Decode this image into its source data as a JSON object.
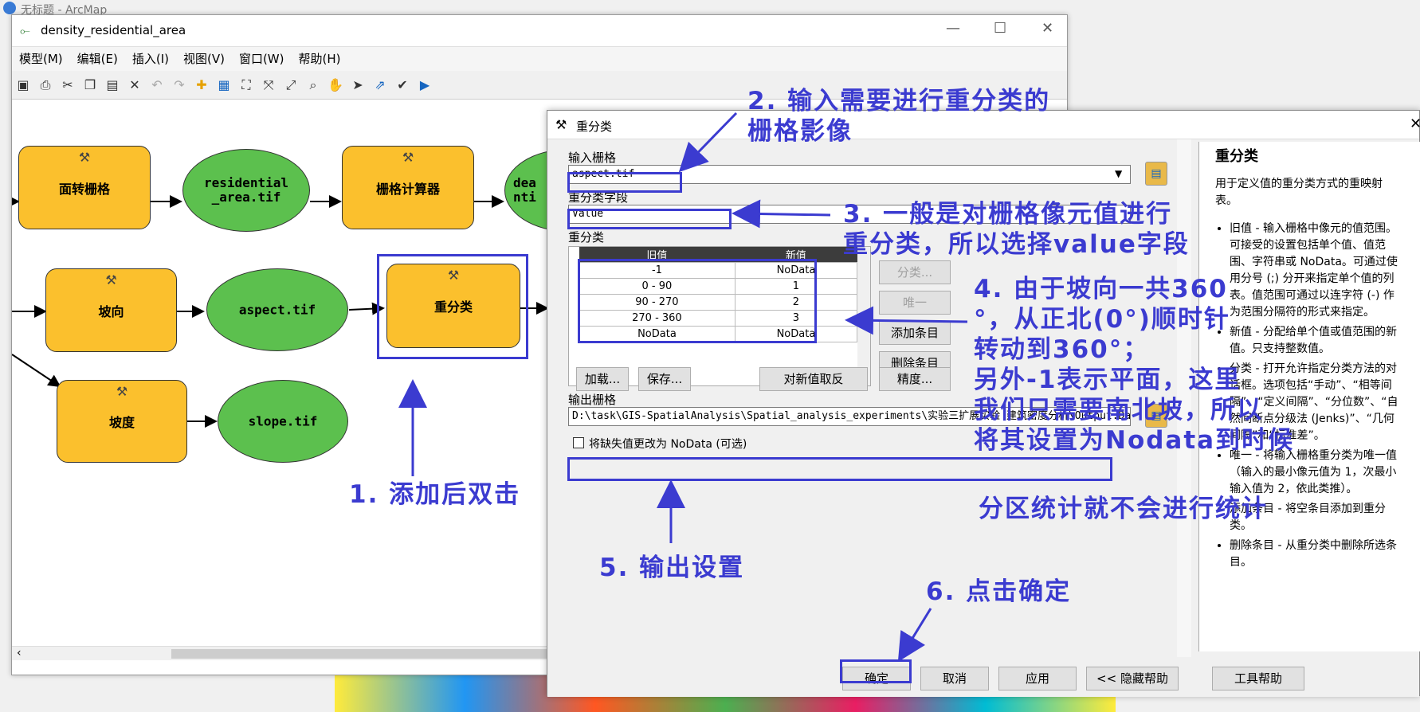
{
  "arcmap": {
    "title": "无标题 - ArcMap"
  },
  "modelbuilder": {
    "title": "density_residential_area",
    "menu": [
      "模型(M)",
      "编辑(E)",
      "插入(I)",
      "视图(V)",
      "窗口(W)",
      "帮助(H)"
    ],
    "nodes": {
      "polygon_to_raster": "面转栅格",
      "residential_tif": "residential\n_area.tif",
      "raster_calc": "栅格计算器",
      "den_partial": "dea\nnti",
      "aspect": "坡向",
      "aspect_tif": "aspect.tif",
      "reclassify": "重分类",
      "slope": "坡度",
      "slope_tif": "slope.tif"
    }
  },
  "dialog": {
    "title": "重分类",
    "input_label": "输入栅格",
    "input_value": "aspect.tif",
    "field_label": "重分类字段",
    "field_value": "Value",
    "reclass_label": "重分类",
    "table_headers": [
      "旧值",
      "新值"
    ],
    "table_rows": [
      [
        "-1",
        "NoData"
      ],
      [
        "0 - 90",
        "1"
      ],
      [
        "90 - 270",
        "2"
      ],
      [
        "270 - 360",
        "3"
      ],
      [
        "NoData",
        "NoData"
      ]
    ],
    "side_buttons": [
      "分类...",
      "唯一",
      "添加条目",
      "删除条目"
    ],
    "bottom_buttons": [
      "加载...",
      "保存...",
      "对新值取反",
      "精度..."
    ],
    "output_label": "输出栅格",
    "output_value": "D:\\task\\GIS-SpatialAnalysis\\Spatial_analysis_experiments\\实验三扩展实验 建筑密度分析\\Output.Dat",
    "nodata_checkbox": "将缺失值更改为 NoData (可选)",
    "ok": "确定",
    "cancel": "取消",
    "apply": "应用",
    "hide_help": "<< 隐藏帮助",
    "tool_help": "工具帮助"
  },
  "help": {
    "title": "重分类",
    "intro": "用于定义值的重分类方式的重映射表。",
    "items": [
      "旧值 - 输入栅格中像元的值范围。可接受的设置包括单个值、值范围、字符串或 NoData。可通过使用分号 (;) 分开来指定单个值的列表。值范围可通过以连字符 (-) 作为范围分隔符的形式来指定。",
      "新值 - 分配给单个值或值范围的新值。只支持整数值。",
      "分类 - 打开允许指定分类方法的对话框。选项包括“手动”、“相等间隔”、“定义间隔”、“分位数”、“自然间断点分级法 (Jenks)”、“几何间隔”和“标准差”。",
      "唯一 - 将输入栅格重分类为唯一值（输入的最小像元值为 1，次最小输入值为 2，依此类推）。",
      "添加条目 - 将空条目添加到重分类。",
      "删除条目 - 从重分类中删除所选条目。"
    ]
  },
  "annotations": {
    "a1": "1. 添加后双击",
    "a2": "2. 输入需要进行重分类的\n栅格影像",
    "a3": "3. 一般是对栅格像元值进行\n重分类，所以选择value字段",
    "a4": "4. 由于坡向一共360\n°，从正北(0°)顺时针\n转动到360°；\n另外-1表示平面，这里\n我们只需要南北坡，所以\n将其设置为Nodata到时候",
    "a4b": "分区统计就不会进行统计",
    "a5": "5. 输出设置",
    "a6": "6. 点击确定"
  },
  "colors": {
    "annotation": "#3b3bd0",
    "node_rect": "#fbc02d",
    "node_oval": "#5cc04e"
  }
}
